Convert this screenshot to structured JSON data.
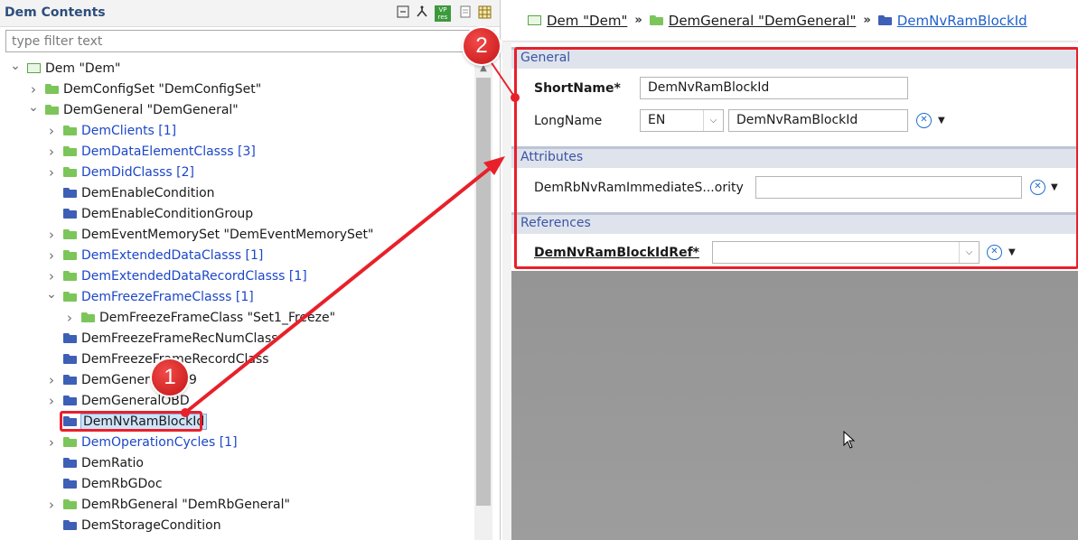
{
  "left_panel": {
    "title": "Dem Contents",
    "toolbar_icons": [
      "collapse-all-icon",
      "link-icon",
      "vp-res-icon",
      "document-icon",
      "grid-icon"
    ],
    "vp_label": "VP",
    "res_label": "res",
    "filter_placeholder": "type filter text",
    "tree": [
      {
        "label": "Dem \"Dem\"",
        "level": 0,
        "expander": "open",
        "icon": "module",
        "link": false
      },
      {
        "label": "DemConfigSet \"DemConfigSet\"",
        "level": 1,
        "expander": "closed",
        "icon": "green",
        "link": false
      },
      {
        "label": "DemGeneral \"DemGeneral\"",
        "level": 1,
        "expander": "open",
        "icon": "green",
        "link": false
      },
      {
        "label": "DemClients [1]",
        "level": 2,
        "expander": "closed",
        "icon": "green",
        "link": true
      },
      {
        "label": "DemDataElementClasss [3]",
        "level": 2,
        "expander": "closed",
        "icon": "green",
        "link": true
      },
      {
        "label": "DemDidClasss [2]",
        "level": 2,
        "expander": "closed",
        "icon": "green",
        "link": true
      },
      {
        "label": "DemEnableCondition",
        "level": 2,
        "expander": "none",
        "icon": "blue",
        "link": false
      },
      {
        "label": "DemEnableConditionGroup",
        "level": 2,
        "expander": "none",
        "icon": "blue",
        "link": false
      },
      {
        "label": "DemEventMemorySet \"DemEventMemorySet\"",
        "level": 2,
        "expander": "closed",
        "icon": "green",
        "link": false
      },
      {
        "label": "DemExtendedDataClasss [1]",
        "level": 2,
        "expander": "closed",
        "icon": "green",
        "link": true
      },
      {
        "label": "DemExtendedDataRecordClasss [1]",
        "level": 2,
        "expander": "closed",
        "icon": "green",
        "link": true
      },
      {
        "label": "DemFreezeFrameClasss [1]",
        "level": 2,
        "expander": "open",
        "icon": "green",
        "link": true
      },
      {
        "label": "DemFreezeFrameClass \"Set1_Freeze\"",
        "level": 3,
        "expander": "closed",
        "icon": "green",
        "link": false
      },
      {
        "label": "DemFreezeFrameRecNumClass",
        "level": 2,
        "expander": "none",
        "icon": "blue",
        "link": false
      },
      {
        "label": "DemFreezeFrameRecordClass",
        "level": 2,
        "expander": "none",
        "icon": "blue",
        "link": false
      },
      {
        "label": "DemGeneralJ1939",
        "level": 2,
        "expander": "closed",
        "icon": "blue",
        "link": false
      },
      {
        "label": "DemGeneralOBD",
        "level": 2,
        "expander": "closed",
        "icon": "blue",
        "link": false
      },
      {
        "label": "DemNvRamBlockId",
        "level": 2,
        "expander": "none",
        "icon": "blue",
        "link": false,
        "selected": true
      },
      {
        "label": "DemOperationCycles [1]",
        "level": 2,
        "expander": "closed",
        "icon": "green",
        "link": true
      },
      {
        "label": "DemRatio",
        "level": 2,
        "expander": "none",
        "icon": "blue",
        "link": false
      },
      {
        "label": "DemRbGDoc",
        "level": 2,
        "expander": "none",
        "icon": "blue",
        "link": false
      },
      {
        "label": "DemRbGeneral \"DemRbGeneral\"",
        "level": 2,
        "expander": "closed",
        "icon": "green",
        "link": false
      },
      {
        "label": "DemStorageCondition",
        "level": 2,
        "expander": "none",
        "icon": "blue",
        "link": false
      }
    ]
  },
  "breadcrumb": [
    {
      "label": "Dem \"Dem\"",
      "icon": "module"
    },
    {
      "label": "DemGeneral \"DemGeneral\"",
      "icon": "green"
    },
    {
      "label": "DemNvRamBlockId",
      "icon": "blue"
    }
  ],
  "breadcrumb_sep": "»",
  "editor": {
    "general": {
      "header": "General",
      "short_name_label": "ShortName*",
      "short_name_value": "DemNvRamBlockId",
      "long_name_label": "LongName",
      "long_name_lang": "EN",
      "long_name_value": "DemNvRamBlockId"
    },
    "attributes": {
      "header": "Attributes",
      "field_label": "DemRbNvRamImmediateS...ority",
      "field_value": ""
    },
    "references": {
      "header": "References",
      "field_label": "DemNvRamBlockIdRef*",
      "field_value": ""
    }
  },
  "annotations": {
    "badge_1": "1",
    "badge_2": "2",
    "color": "#e8202a"
  },
  "colors": {
    "link": "#1c46c8",
    "section_header_text": "#3a55a5",
    "folder_green": "#7cc55a",
    "folder_blue": "#3d5fb5"
  }
}
